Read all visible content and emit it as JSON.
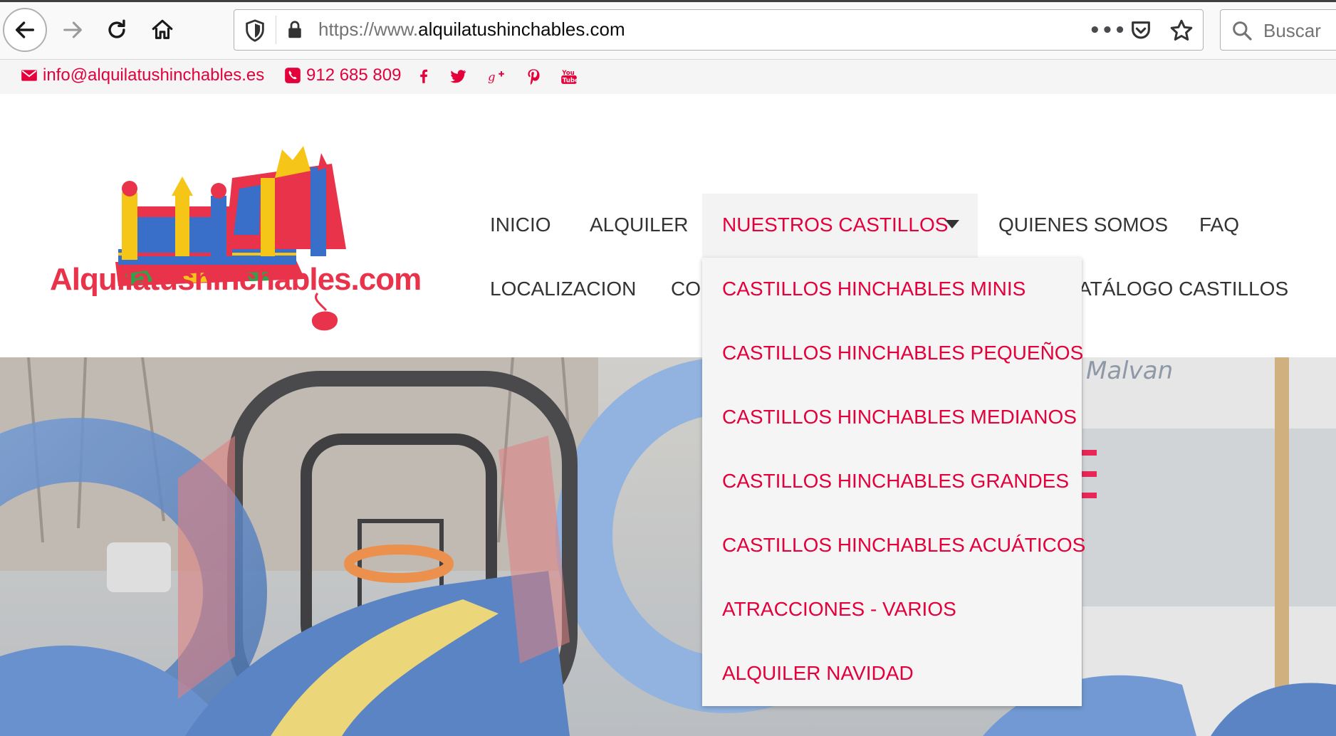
{
  "browser": {
    "url_prefix": "https://www.",
    "url_domain": "alquilatushinchables.com",
    "more_label": "•••",
    "search_placeholder": "Buscar"
  },
  "contact": {
    "email": "info@alquilatushinchables.es",
    "phone": "912 685 809",
    "social": [
      "facebook-icon",
      "twitter-icon",
      "google-plus-icon",
      "pinterest-icon",
      "youtube-icon"
    ]
  },
  "logo": {
    "text": "Alquilatushinchables.com"
  },
  "menu": {
    "inicio": "INICIO",
    "alquiler": "ALQUILER",
    "nuestros": "NUESTROS CASTILLOS",
    "quienes": "QUIENES SOMOS",
    "faq": "FAQ",
    "localizacion": "LOCALIZACION",
    "contacto_partial": "CO",
    "catalogo_partial": "ATÁLOGO CASTILLOS"
  },
  "dropdown": [
    "CASTILLOS HINCHABLES MINIS",
    "CASTILLOS HINCHABLES PEQUEÑOS",
    "CASTILLOS HINCHABLES MEDIANOS",
    "CASTILLOS HINCHABLES GRANDES",
    "CASTILLOS HINCHABLES ACUÁTICOS",
    "ATRACCIONES - VARIOS",
    "ALQUILER NAVIDAD"
  ],
  "hero": {
    "sign_text": "Malvan"
  },
  "colors": {
    "accent": "#e4003b",
    "text": "#333333"
  }
}
